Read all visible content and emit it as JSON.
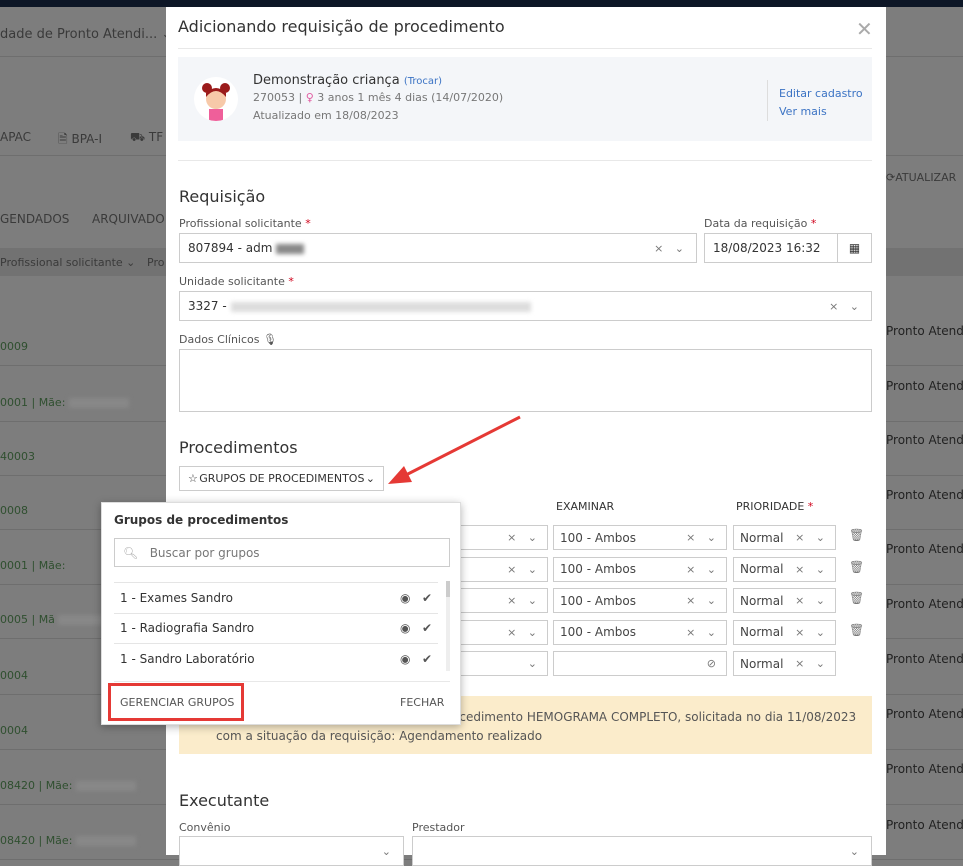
{
  "background": {
    "unit_select": "dade de Pronto Atendi...",
    "nav": [
      "APAC",
      "BPA-I",
      "TF"
    ],
    "tabs": [
      "GENDADOS",
      "ARQUIVADO"
    ],
    "filters": [
      "Profissional solicitante",
      "Pro"
    ],
    "refresh": "ATUALIZAR",
    "rows": [
      "0009",
      "0001 | Mãe:",
      "40003",
      "0008",
      "0001 | Mãe:",
      "0005 | Mã",
      "0004",
      "0004",
      "08420 | Mãe:",
      "08420 | Mãe:"
    ],
    "right_rows": [
      "Pronto Atendi",
      "Pronto Atendi",
      "Pronto Atendi",
      "Pronto Atendi",
      "Pronto Atendi",
      "Pronto Atendi",
      "Pronto Atendi",
      "Pronto Atendi",
      "Pronto Atendi",
      "Pronto Atendi"
    ]
  },
  "modal": {
    "title": "Adicionando requisição de procedimento",
    "patient": {
      "name": "Demonstração criança",
      "swap": "(Trocar)",
      "id": "270053",
      "age": "3 anos 1 mês 4 dias (14/07/2020)",
      "updated": "Atualizado em 18/08/2023",
      "edit": "Editar cadastro",
      "more": "Ver mais"
    },
    "requisicao": {
      "heading": "Requisição",
      "prof_label": "Profissional solicitante",
      "prof_value": "807894 - adm",
      "date_label": "Data da requisição",
      "date_value": "18/08/2023 16:32",
      "unit_label": "Unidade solicitante",
      "unit_value": "3327 -",
      "clinical_label": "Dados Clínicos"
    },
    "procedimentos": {
      "heading": "Procedimentos",
      "groups_button": "GRUPOS DE PROCEDIMENTOS",
      "col_examinar": "EXAMINAR",
      "col_prioridade": "PRIORIDADE",
      "rows": [
        {
          "examinar": "100 - Ambos",
          "prioridade": "Normal"
        },
        {
          "examinar": "100 - Ambos",
          "prioridade": "Normal"
        },
        {
          "examinar": "100 - Ambos",
          "prioridade": "Normal"
        },
        {
          "examinar": "100 - Ambos",
          "prioridade": "Normal"
        },
        {
          "examinar": "",
          "prioridade": "Normal"
        }
      ]
    },
    "warning": {
      "line1": "ocedimento HEMOGRAMA COMPLETO, solicitada no dia 11/08/2023",
      "line2": "com a situação da requisição: Agendamento realizado"
    },
    "executante": {
      "heading": "Executante",
      "convenio_label": "Convênio",
      "prestador_label": "Prestador"
    }
  },
  "popover": {
    "title": "Grupos de procedimentos",
    "search_placeholder": "Buscar por grupos",
    "items": [
      "1 - Exames Sandro",
      "1 - Radiografia Sandro",
      "1 - Sandro Laboratório"
    ],
    "manage": "GERENCIAR GRUPOS",
    "close": "FECHAR"
  },
  "colors": {
    "accent": "#3b73c4",
    "required": "#d0021b",
    "warning_bg": "#fbeccb",
    "annotation": "#e53935"
  }
}
